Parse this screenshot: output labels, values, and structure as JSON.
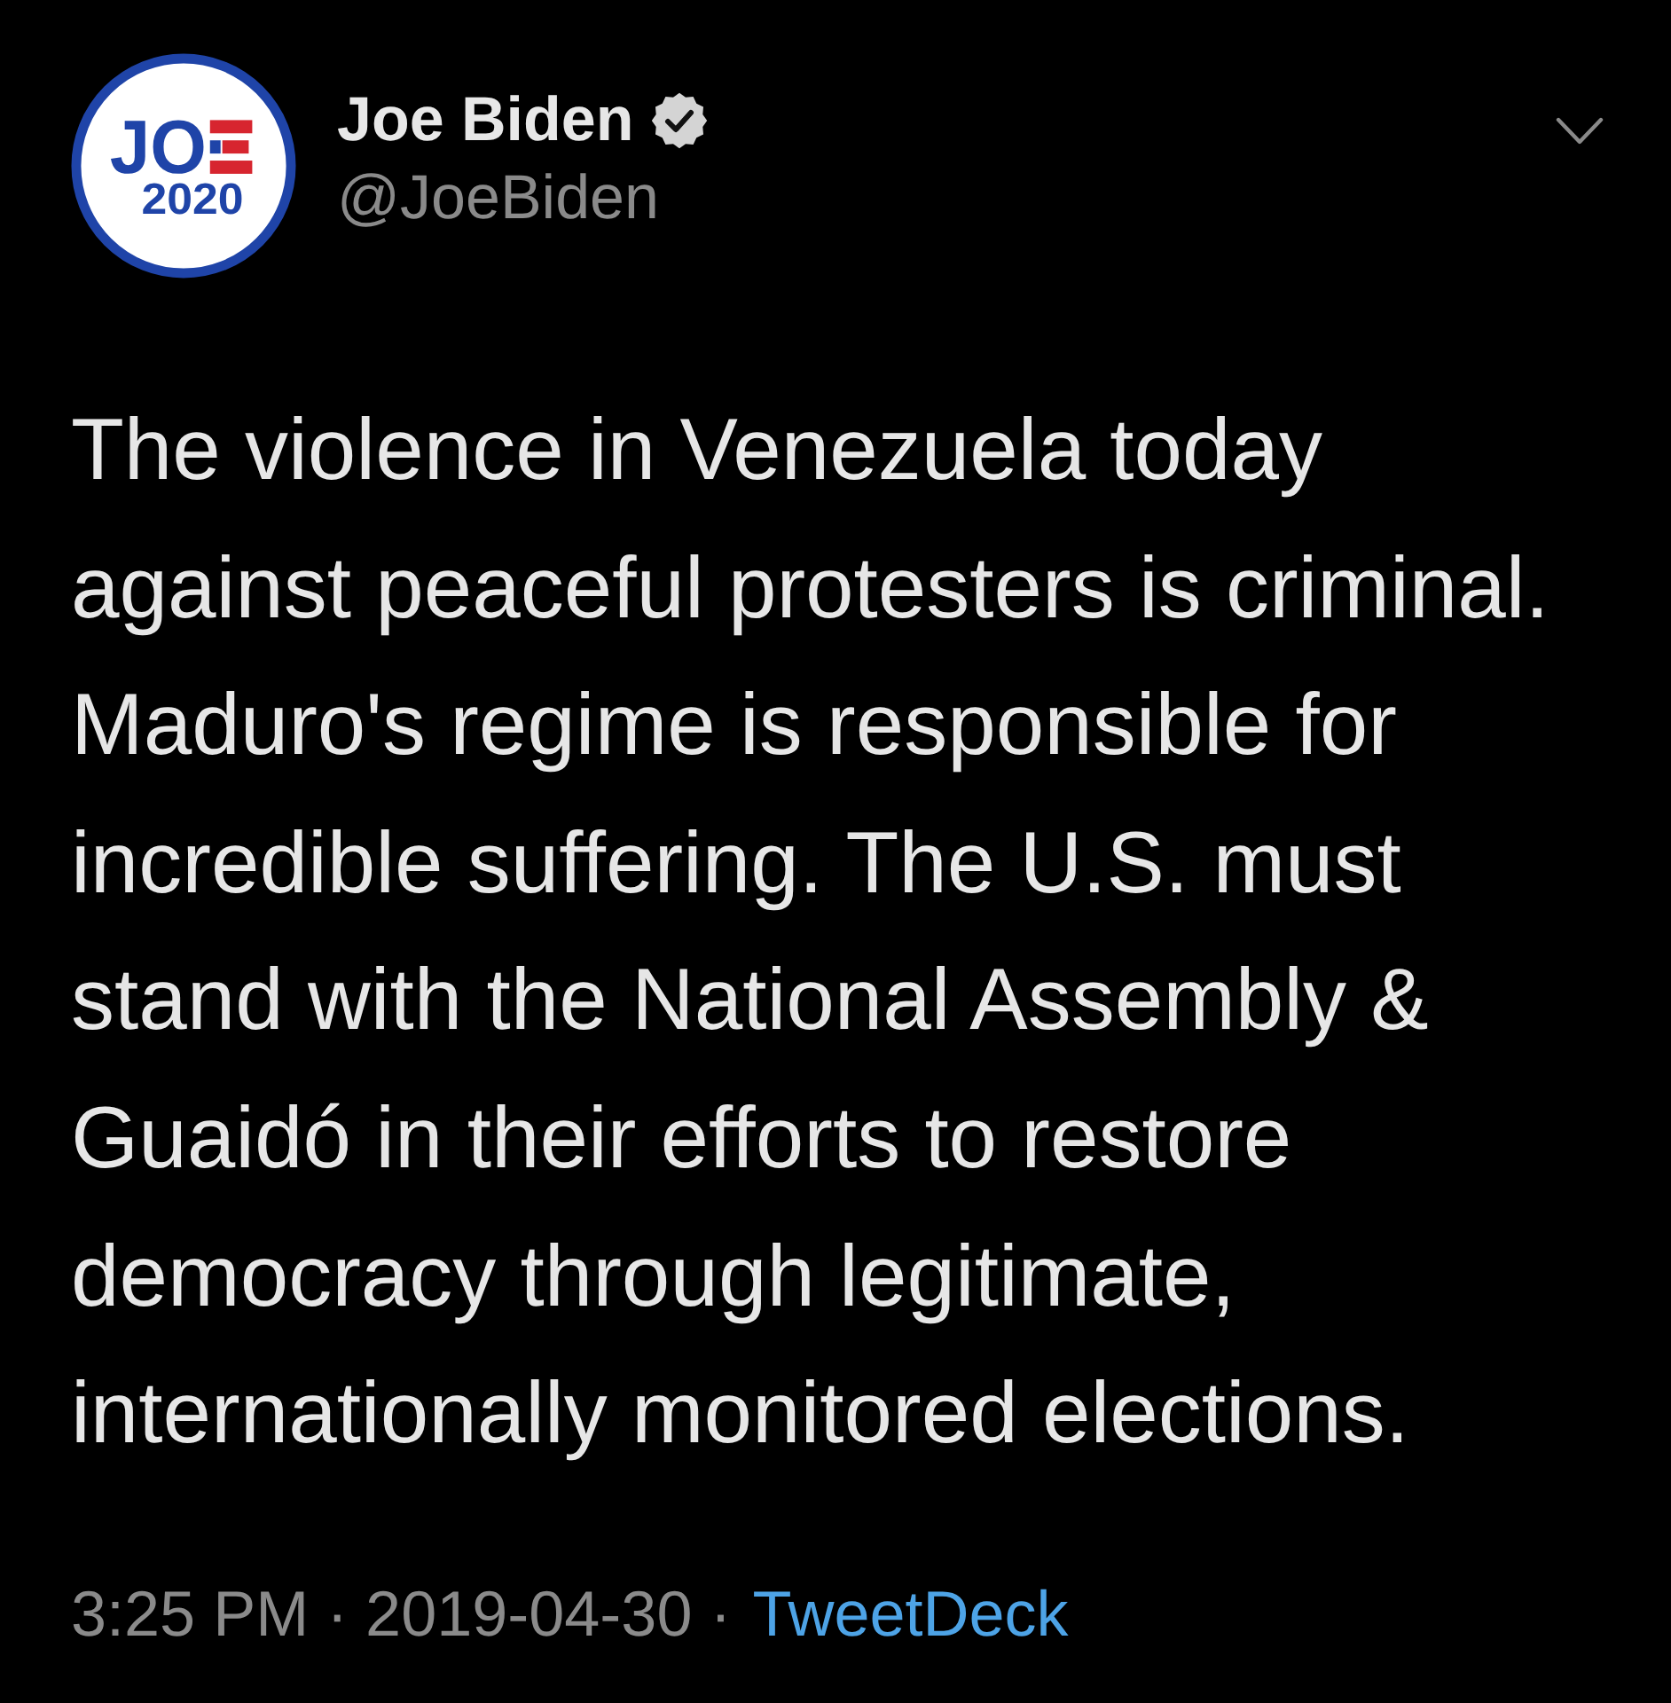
{
  "tweet": {
    "author": {
      "avatar": {
        "logo_text": "JO",
        "logo_year": "2020"
      },
      "name": "Joe Biden",
      "verified": true,
      "handle": "@JoeBiden"
    },
    "text": "The violence in Venezuela today against peaceful protesters is criminal. Maduro's regime is responsible for incredible suffering. The U.S. must stand with the National Assembly & Guaidó in their efforts to restore democracy through legitimate, internationally monitored elections.",
    "timestamp": "3:25 PM · 2019-04-30",
    "separator": "·",
    "source": "TweetDeck"
  }
}
